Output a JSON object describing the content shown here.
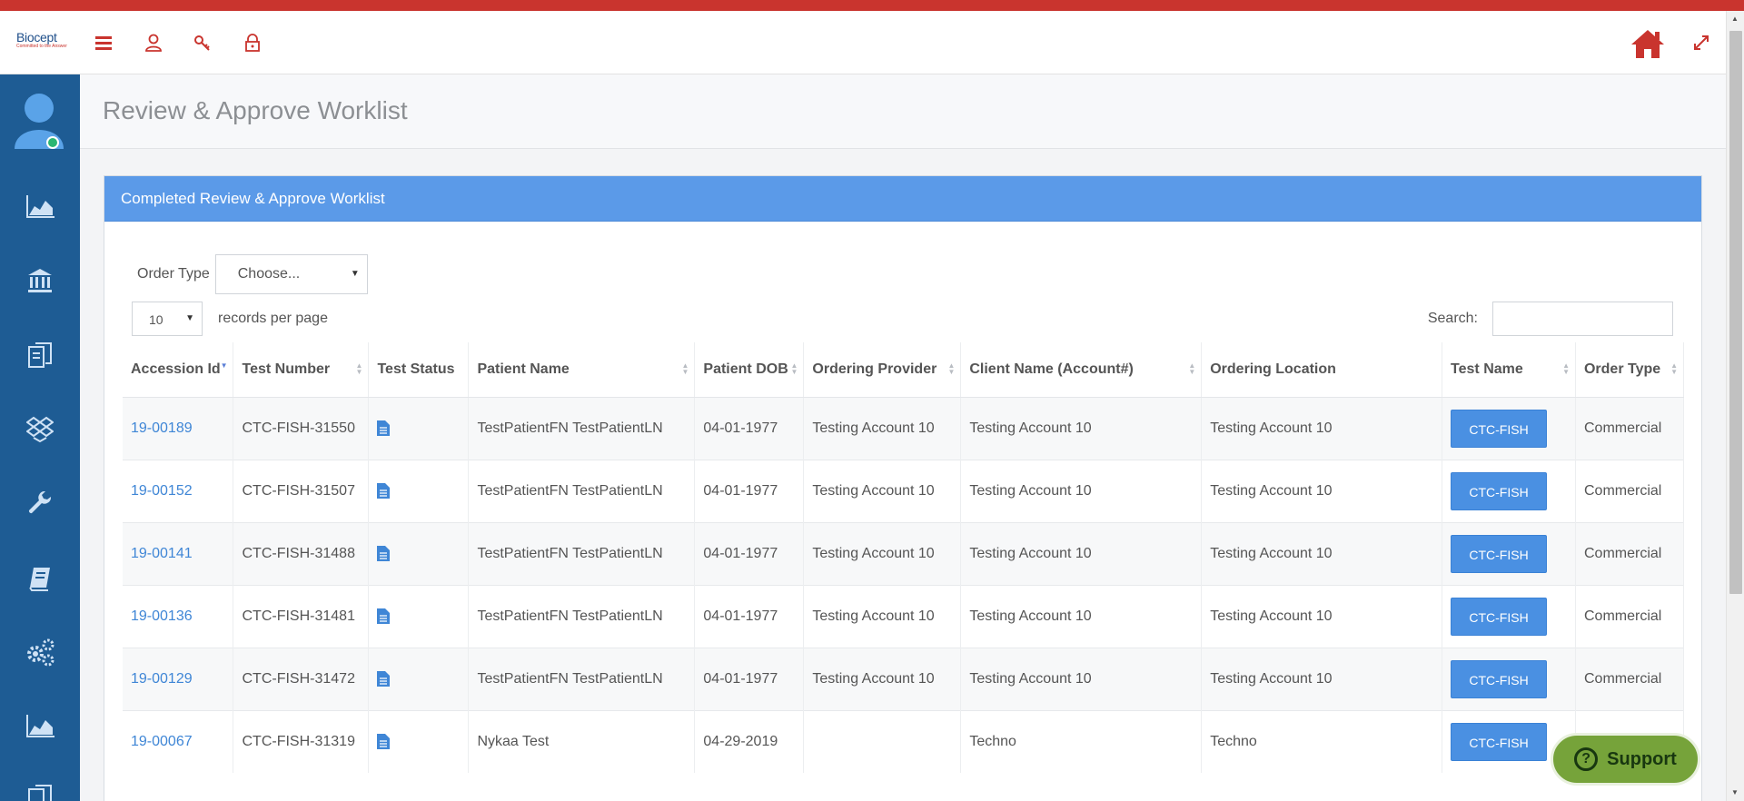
{
  "app": {
    "logo_text": "Biocept",
    "logo_tagline": "Committed to the Answer",
    "icons": [
      "menu-icon",
      "user-icon",
      "key-icon",
      "lock-icon",
      "home-icon",
      "expand-icon"
    ]
  },
  "colors": {
    "accent_red": "#c9342e",
    "sidebar_blue": "#1e5c94",
    "panel_blue": "#5b9ae8",
    "button_blue": "#4a90e2",
    "support_green": "#76a33a"
  },
  "sidebar": {
    "items": [
      "user-avatar",
      "dashboard-chart-icon",
      "bank-icon",
      "documents-icon",
      "dropbox-icon",
      "wrench-icon",
      "book-icon",
      "settings-gears-icon",
      "reports-chart-icon",
      "copy-icon"
    ]
  },
  "page": {
    "title": "Review & Approve Worklist"
  },
  "panel": {
    "heading": "Completed Review & Approve Worklist"
  },
  "filters": {
    "order_type_label": "Order Type",
    "order_type_value": "Choose...",
    "page_length_value": "10",
    "page_length_label": "records per page",
    "search_label": "Search:",
    "search_value": ""
  },
  "table": {
    "columns": [
      "Accession Id",
      "Test Number",
      "Test Status",
      "Patient Name",
      "Patient DOB",
      "Ordering Provider",
      "Client Name (Account#)",
      "Ordering Location",
      "Test Name",
      "Order Type"
    ],
    "rows": [
      {
        "accession": "19-00189",
        "test_number": "CTC-FISH-31550",
        "patient": "TestPatientFN TestPatientLN",
        "dob": "04-01-1977",
        "provider": "Testing Account 10",
        "client": "Testing Account 10",
        "location": "Testing Account 10",
        "test_name": "CTC-FISH",
        "order_type": "Commercial"
      },
      {
        "accession": "19-00152",
        "test_number": "CTC-FISH-31507",
        "patient": "TestPatientFN TestPatientLN",
        "dob": "04-01-1977",
        "provider": "Testing Account 10",
        "client": "Testing Account 10",
        "location": "Testing Account 10",
        "test_name": "CTC-FISH",
        "order_type": "Commercial"
      },
      {
        "accession": "19-00141",
        "test_number": "CTC-FISH-31488",
        "patient": "TestPatientFN TestPatientLN",
        "dob": "04-01-1977",
        "provider": "Testing Account 10",
        "client": "Testing Account 10",
        "location": "Testing Account 10",
        "test_name": "CTC-FISH",
        "order_type": "Commercial"
      },
      {
        "accession": "19-00136",
        "test_number": "CTC-FISH-31481",
        "patient": "TestPatientFN TestPatientLN",
        "dob": "04-01-1977",
        "provider": "Testing Account 10",
        "client": "Testing Account 10",
        "location": "Testing Account 10",
        "test_name": "CTC-FISH",
        "order_type": "Commercial"
      },
      {
        "accession": "19-00129",
        "test_number": "CTC-FISH-31472",
        "patient": "TestPatientFN TestPatientLN",
        "dob": "04-01-1977",
        "provider": "Testing Account 10",
        "client": "Testing Account 10",
        "location": "Testing Account 10",
        "test_name": "CTC-FISH",
        "order_type": "Commercial"
      },
      {
        "accession": "19-00067",
        "test_number": "CTC-FISH-31319",
        "patient": "Nykaa Test",
        "dob": "04-29-2019",
        "provider": "",
        "client": "Techno",
        "location": "Techno",
        "test_name": "CTC-FISH",
        "order_type": ""
      }
    ]
  },
  "support": {
    "label": "Support"
  }
}
